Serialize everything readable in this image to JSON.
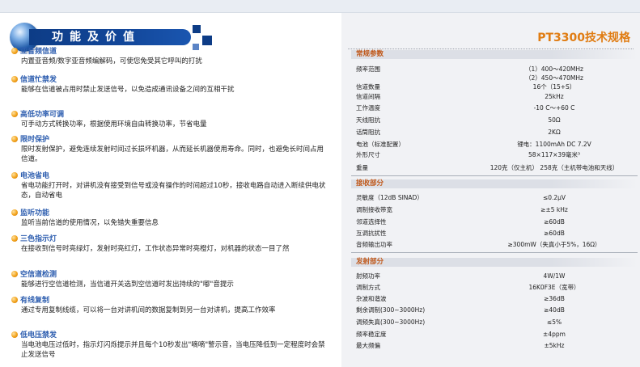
{
  "banner": {
    "title": "功能及价值"
  },
  "features": [
    {
      "title": "亚音频信道",
      "desc": "内置亚音频/数字亚音频编解码，可使您免受其它呼叫的打扰"
    },
    {
      "title": "信道忙禁发",
      "desc": "能够在信道被占用时禁止发送信号，以免造成通讯设备之间的互相干扰"
    },
    {
      "title": "高低功率可调",
      "desc": "可手动方式转换功率，根据使用环境自由转换功率，节省电量"
    },
    {
      "title": "限时保护",
      "desc": "限时发射保护，避免连续发射时间过长损坏机器，从而延长机器使用寿命。同时，也避免长时间占用信道。"
    },
    {
      "title": "电池省电",
      "desc": "省电功能打开时，对讲机没有接受到信号或没有操作的时间超过10秒，接收电路自动进入断续供电状态，自动省电"
    },
    {
      "title": "监听功能",
      "desc": "监听当前信道的使用情况，以免错失重要信息"
    },
    {
      "title": "三色指示灯",
      "desc": "在接收到信号时亮绿灯，发射时亮红灯，工作状态异常时亮橙灯，对机器的状态一目了然"
    },
    {
      "title": "空信道检测",
      "desc": "能够进行空信道检测，当信道开关选到空信道时发出持续的\"嘟\"音提示"
    },
    {
      "title": "有线复制",
      "desc": "通过专用复制线缆，可以将一台对讲机间的数据复制到另一台对讲机，提高工作效率"
    },
    {
      "title": "低电压禁发",
      "desc": "当电池电压过低时，指示灯闪烁提示并且每个10秒发出\"嘀嘀\"警示音，当电压降低到一定程度时会禁止发送信号"
    }
  ],
  "spec": {
    "title": "PT3300技术规格",
    "sections": [
      {
        "name": "常规参数",
        "rows": [
          {
            "k": "频率范围",
            "v": "（1）400～420MHz"
          },
          {
            "k": "",
            "v": "（2）450～470MHz"
          },
          {
            "k": "信道数量",
            "v": "16个（15+S）"
          },
          {
            "k": "信道间隔",
            "v": "25kHz"
          },
          {
            "k": "工作温度",
            "v": "-10 C～+60 C"
          },
          {
            "k": "天线阻抗",
            "v": "50Ω"
          },
          {
            "k": "话筒阻抗",
            "v": "2KΩ"
          },
          {
            "k": "电池（标准配置）",
            "v": "锂电：1100mAh  DC 7.2V"
          },
          {
            "k": "外形尺寸",
            "v": "58×117×39毫米³"
          },
          {
            "k": "重量",
            "v": "120克（仅主机）  258克（主机带电池和天线）"
          }
        ]
      },
      {
        "name": "接收部分",
        "rows": [
          {
            "k": "灵敏度（12dB SINAD）",
            "v": "≤0.2μV"
          },
          {
            "k": "调制接收带宽",
            "v": "≥±5 kHz"
          },
          {
            "k": "邻道选择性",
            "v": "≥60dB"
          },
          {
            "k": "互调抗扰性",
            "v": "≥60dB"
          },
          {
            "k": "音频输出功率",
            "v": "≥300mW（失真小于5%，16Ω）"
          }
        ]
      },
      {
        "name": "发射部分",
        "rows": [
          {
            "k": "射频功率",
            "v": "4W/1W"
          },
          {
            "k": "调制方式",
            "v": "16K0F3E（宽带）"
          },
          {
            "k": "杂波和谐波",
            "v": "≥36dB"
          },
          {
            "k": "剩余调制(300~3000Hz)",
            "v": "≥40dB"
          },
          {
            "k": "调频失真(300~3000Hz)",
            "v": "≤5%"
          },
          {
            "k": "频率稳定度",
            "v": "±4ppm"
          },
          {
            "k": "最大频偏",
            "v": "±5kHz"
          }
        ]
      }
    ]
  },
  "colors": {
    "feature_title": "#2f5fb0",
    "banner": "#0d3c86",
    "spec_title": "#e07c12",
    "section_title": "#c0581a"
  }
}
